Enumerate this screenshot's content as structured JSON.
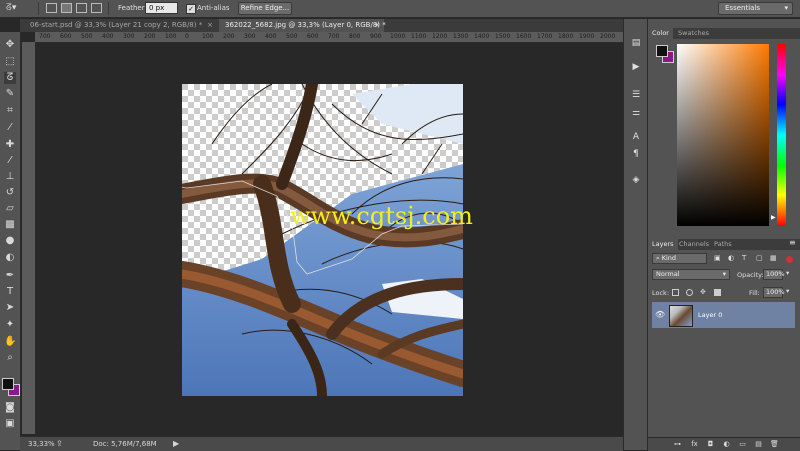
{
  "options_bar": {
    "feather_label": "Feather:",
    "feather_value": "0 px",
    "antialias_label": "Anti-alias",
    "antialias_checked": true,
    "refine_edge_label": "Refine Edge...",
    "workspace_value": "Essentials"
  },
  "tabs": [
    {
      "label": "06-start.psd @ 33,3% (Layer 21 copy 2, RGB/8) *",
      "close": "×",
      "active": false
    },
    {
      "label": "362022_5682.jpg @ 33,3% (Layer 0, RGB/8) *",
      "close": "×",
      "active": true
    }
  ],
  "ruler_labels": [
    "700",
    "600",
    "500",
    "400",
    "300",
    "200",
    "100",
    "0",
    "100",
    "200",
    "300",
    "400",
    "500",
    "600",
    "700",
    "800",
    "900",
    "1000",
    "1100",
    "1200",
    "1300",
    "1400",
    "1500",
    "1600",
    "1700",
    "1800",
    "1900",
    "2000"
  ],
  "watermark": "www.cgtsj.com",
  "status": {
    "zoom": "33,33%",
    "doc": "Doc: 5,76M/7,68M"
  },
  "color_panel": {
    "tabs": [
      "Color",
      "Swatches"
    ],
    "foreground": "#111111",
    "background": "#8a1a8a",
    "hue_color": "#ff7a00"
  },
  "layers_panel": {
    "tabs": [
      "Layers",
      "Channels",
      "Paths"
    ],
    "filter_kind": "Kind",
    "blend_mode": "Normal",
    "opacity_label": "Opacity:",
    "opacity_value": "100%",
    "lock_label": "Lock:",
    "fill_label": "Fill:",
    "fill_value": "100%",
    "layers": [
      {
        "name": "Layer 0",
        "visible": true,
        "selected": true
      }
    ]
  },
  "icons": {
    "toolbox": [
      "move-icon",
      "marquee-icon",
      "lasso-icon",
      "quick-select-icon",
      "crop-icon",
      "eyedropper-icon",
      "healing-brush-icon",
      "brush-icon",
      "clone-stamp-icon",
      "history-brush-icon",
      "eraser-icon",
      "gradient-icon",
      "blur-icon",
      "dodge-icon",
      "pen-icon",
      "type-icon",
      "path-select-icon",
      "shape-icon",
      "hand-icon",
      "zoom-icon"
    ],
    "strip": [
      "history-icon",
      "actions-icon",
      "properties-icon",
      "adjustments-icon",
      "character-icon",
      "paragraph-icon",
      "3d-icon"
    ],
    "layer_footer": [
      "link-icon",
      "fx-icon",
      "mask-icon",
      "adjustment-layer-icon",
      "group-icon",
      "new-layer-icon",
      "trash-icon"
    ]
  }
}
